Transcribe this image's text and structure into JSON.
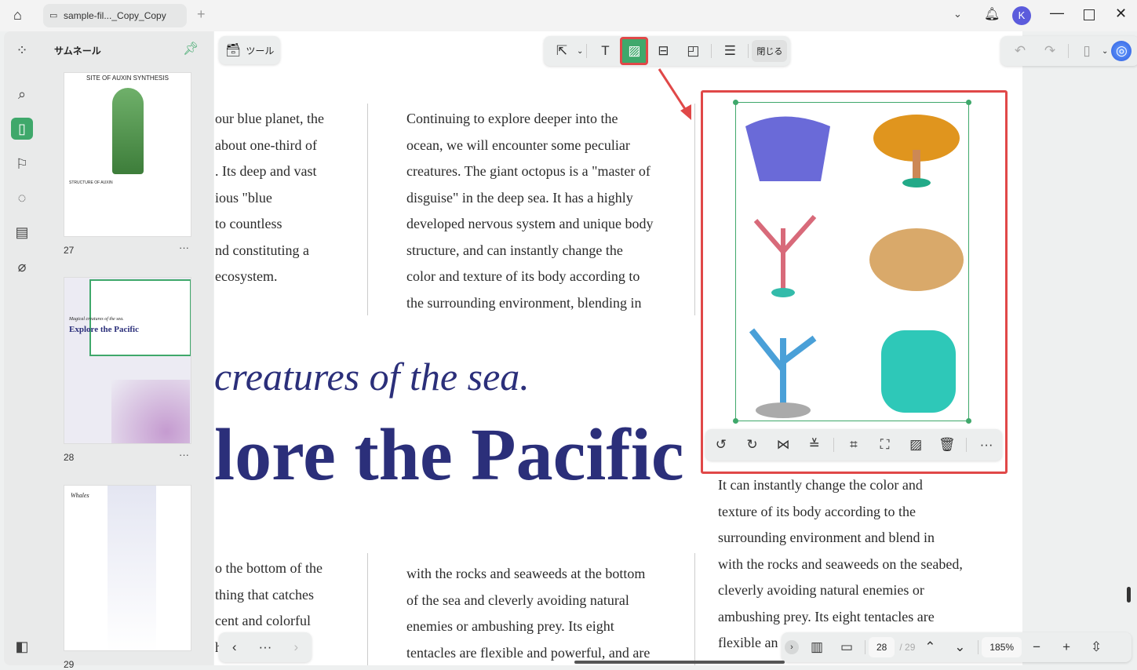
{
  "window": {
    "tab_title": "sample-fil..._Copy_Copy",
    "avatar_letter": "K"
  },
  "sidebar": {
    "title": "サムネール",
    "pages": [
      {
        "number": "27",
        "heading": "SITE OF AUXIN SYNTHESIS",
        "subheading": "STRUCTURE OF AUXIN"
      },
      {
        "number": "28",
        "heading": "Explore the Pacific",
        "subheading": "Magical creatures of the sea."
      },
      {
        "number": "29",
        "heading": "Whales"
      }
    ],
    "more": "···"
  },
  "toolbar": {
    "tools_label": "ツール",
    "close_label": "閉じる"
  },
  "document": {
    "col1_top": [
      "our blue planet, the",
      "about one-third of",
      ". Its deep and vast",
      "ious \"blue",
      "to countless",
      "nd constituting a",
      "ecosystem."
    ],
    "col2_top": [
      "Continuing to explore deeper into the",
      "ocean, we will encounter some peculiar",
      "creatures. The giant octopus is a \"master of",
      "disguise\" in the deep sea. It has a highly",
      "developed nervous system and unique body",
      "structure, and can instantly change the",
      "color and texture of its body according to",
      "the surrounding environment, blending in"
    ],
    "subtitle": "creatures of the sea.",
    "title": "lore the Pacific",
    "col1_bottom": [
      "o the bottom of the",
      "thing that catches",
      "cent and colorful",
      "he"
    ],
    "col2_bottom": [
      "with the rocks and seaweeds at the bottom",
      "of the sea and cleverly avoiding natural",
      "enemies or ambushing prey. Its eight",
      "tentacles are flexible and powerful, and are"
    ],
    "col3_bottom": [
      "It can instantly change the color and",
      "texture of its body according to the",
      "surrounding environment and blend in",
      "with the rocks and seaweeds on the seabed,",
      "cleverly avoiding natural enemies or",
      "ambushing prey. Its eight tentacles are",
      "flexible an"
    ]
  },
  "bottom_bar": {
    "current_page": "28",
    "total_pages": "/ 29",
    "zoom": "185%"
  },
  "colors": {
    "accent_green": "#3fa86b",
    "highlight_red": "#e04848",
    "title_navy": "#2b2f7a"
  }
}
